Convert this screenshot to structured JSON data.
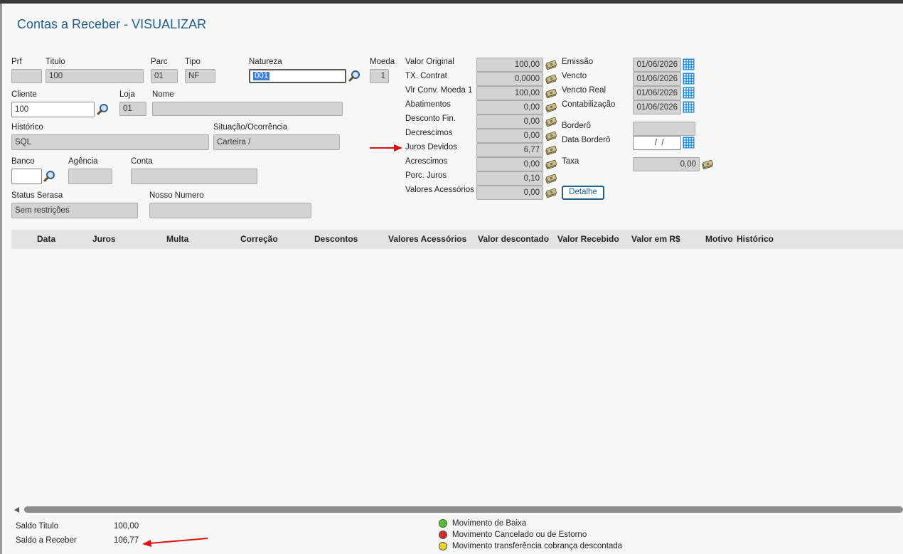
{
  "header": {
    "title": "Contas a Receber - VISUALIZAR"
  },
  "form": {
    "prf": {
      "label": "Prf",
      "value": ""
    },
    "titulo": {
      "label": "Titulo",
      "value": "100"
    },
    "parc": {
      "label": "Parc",
      "value": "01"
    },
    "tipo": {
      "label": "Tipo",
      "value": "NF"
    },
    "natureza": {
      "label": "Natureza",
      "value": "001"
    },
    "moeda": {
      "label": "Moeda",
      "value": "1"
    },
    "cliente": {
      "label": "Cliente",
      "value": "100"
    },
    "loja": {
      "label": "Loja",
      "value": "01"
    },
    "nome": {
      "label": "Nome",
      "value": ""
    },
    "historico": {
      "label": "Histórico",
      "value": "SQL"
    },
    "situacao": {
      "label": "Situação/Ocorrência",
      "value": "Carteira /"
    },
    "banco": {
      "label": "Banco",
      "value": ""
    },
    "agencia": {
      "label": "Agência",
      "value": ""
    },
    "conta": {
      "label": "Conta",
      "value": ""
    },
    "status_serasa": {
      "label": "Status Serasa",
      "value": "Sem restrições"
    },
    "nosso_numero": {
      "label": "Nosso Numero",
      "value": ""
    }
  },
  "values": [
    {
      "label": "Valor Original",
      "value": "100,00"
    },
    {
      "label": "TX. Contrat",
      "value": "0,0000"
    },
    {
      "label": "Vlr Conv. Moeda 1",
      "value": "100,00"
    },
    {
      "label": "Abatimentos",
      "value": "0,00"
    },
    {
      "label": "Desconto Fin.",
      "value": "0,00"
    },
    {
      "label": "Decrescimos",
      "value": "0,00"
    },
    {
      "label": "Juros Devidos",
      "value": "6,77"
    },
    {
      "label": "Acrescimos",
      "value": "0,00"
    },
    {
      "label": "Porc. Juros",
      "value": "0,10"
    },
    {
      "label": "Valores Acessórios",
      "value": "0,00"
    }
  ],
  "dates": [
    {
      "label": "Emissão",
      "value": "01/06/2026"
    },
    {
      "label": "Vencto",
      "value": "01/06/2026"
    },
    {
      "label": "Vencto Real",
      "value": "01/06/2026"
    },
    {
      "label": "Contabilização",
      "value": "01/06/2026"
    }
  ],
  "bordero": {
    "label": "Borderô",
    "value": ""
  },
  "data_bordero": {
    "label": "Data Borderô",
    "value": "  /  /"
  },
  "taxa": {
    "label": "Taxa",
    "value": "0,00"
  },
  "detalhe_button": "Detalhe",
  "grid": {
    "columns": [
      "Data",
      "Juros",
      "Multa",
      "Correção",
      "Descontos",
      "Valores Acessórios",
      "Valor descontado",
      "Valor Recebido",
      "Valor em R$",
      "Motivo",
      "Histórico"
    ]
  },
  "footer": {
    "saldo_titulo": {
      "label": "Saldo Titulo",
      "value": "100,00"
    },
    "saldo_receber": {
      "label": "Saldo a Receber",
      "value": "106,77"
    }
  },
  "legend": [
    {
      "label": "Movimento de Baixa",
      "color": "#4fc22b"
    },
    {
      "label": "Movimento Cancelado ou de Estorno",
      "color": "#d8282a"
    },
    {
      "label": "Movimento transferência cobrança descontada",
      "color": "#e6d620"
    }
  ],
  "colors": {
    "title": "#1f5f8b",
    "annotation_arrow": "#e01010"
  }
}
